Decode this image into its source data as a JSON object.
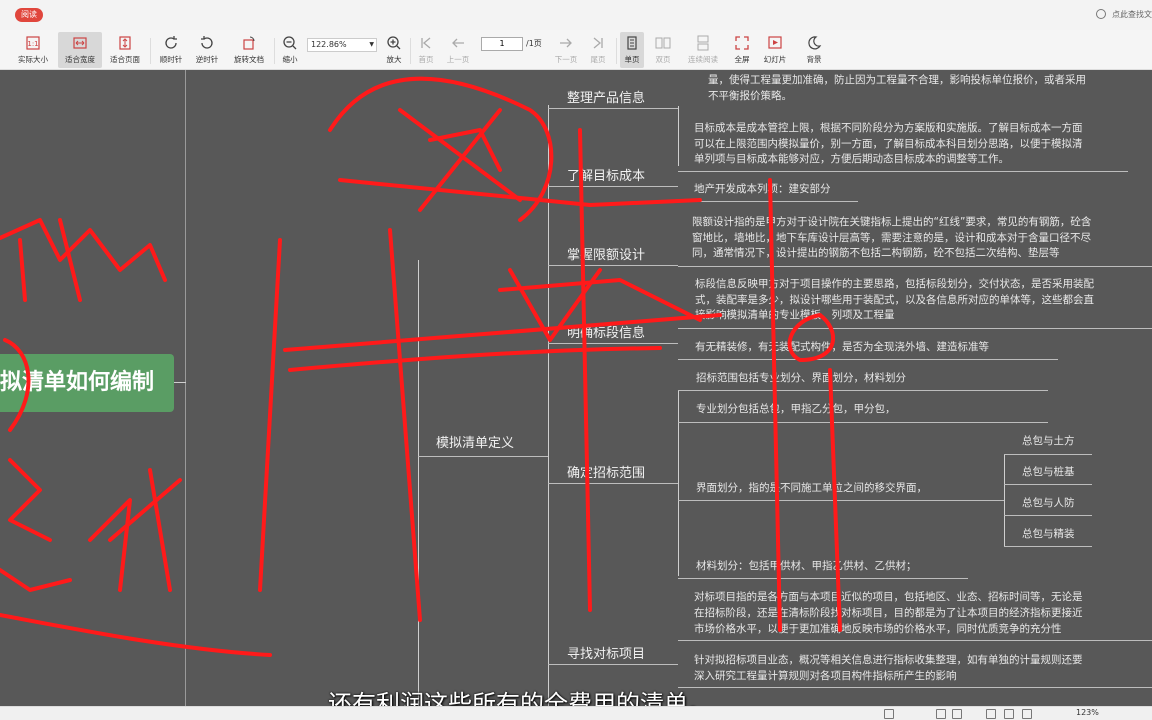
{
  "topbar": {
    "mode_badge": "阅读",
    "search_placeholder": "点此查找文"
  },
  "toolbar": {
    "actual_size": "实际大小",
    "fit_width": "适合宽度",
    "fit_page": "适合页面",
    "rotate_cw": "顺时针",
    "rotate_ccw": "逆时针",
    "rotate_doc": "旋转文档",
    "zoom_out": "缩小",
    "zoom_value": "122.86%",
    "zoom_in": "放大",
    "first_page": "首页",
    "prev_page": "上一页",
    "page_current": "1",
    "page_total": "/1页",
    "next_page": "下一页",
    "last_page": "尾页",
    "single_page": "单页",
    "double_page": "双页",
    "continuous": "连续阅读",
    "fullscreen": "全屏",
    "slideshow": "幻灯片",
    "background": "背景"
  },
  "mindmap": {
    "root": "拟清单如何编制",
    "branch": "模拟清单定义",
    "nodes": [
      "整理产品信息",
      "了解目标成本",
      "掌握限额设计",
      "明确标段信息",
      "确定招标范围",
      "寻找对标项目"
    ],
    "leaves": {
      "product_info": [
        "量，使得工程量更加准确，防止因为工程量不合理，影响投标单位报价，或者采用",
        "不平衡报价策略。"
      ],
      "target_cost": [
        "目标成本是成本管控上限，根据不同阶段分为方案版和实施版。了解目标成本一方面",
        "可以在上限范围内模拟量价，别一方面，了解目标成本科目划分思路，以便于模拟清",
        "单列项与目标成本能够对应，方便后期动态目标成本的调整等工作。"
      ],
      "cost_items": "地产开发成本列项：建安部分",
      "limit_design": [
        "限额设计指的是甲方对于设计院在关键指标上提出的“红线”要求，常见的有钢筋，砼含",
        "窗地比，墙地比，地下车库设计层高等，需要注意的是，设计和成本对于含量口径不尽",
        "同，通常情况下，设计提出的钢筋不包括二构钢筋，砼不包括二次结构、垫层等"
      ],
      "section_info": [
        "标段信息反映甲方对于项目操作的主要思路，包括标段划分，交付状态，是否采用装配",
        "式，装配率是多少，拟设计哪些用于装配式，以及各信息所对应的单体等，这些都会直",
        "接影响模拟清单的专业模板、列项及工程量"
      ],
      "decoration": "有无精装修，有无装配式构件，是否为全现浇外墙、建造标准等",
      "scope_intro": "招标范围包括专业划分、界面划分，材料划分",
      "scope_pro": "专业划分包括总包，甲指乙分包，甲分包，",
      "scope_interface": "界面划分，指的是不同施工单位之间的移交界面，",
      "scope_interface_items": [
        "总包与土方",
        "总包与桩基",
        "总包与人防",
        "总包与精装"
      ],
      "scope_material": "材料划分：包括甲供材、甲指乙供材、乙供材；",
      "benchmark_1": [
        "对标项目指的是各方面与本项目近似的项目，包括地区、业态、招标时间等，无论是",
        "在招标阶段，还是在清标阶段找对标项目，目的都是为了让本项目的经济指标更接近",
        "市场价格水平，以便于更加准确地反映市场的价格水平，同时优质竞争的充分性"
      ],
      "benchmark_2": [
        "针对拟招标项目业态，概况等相关信息进行指标收集整理，如有单独的计量规则还要",
        "深入研究工程量计算规则对各项目构件指标所产生的影响"
      ]
    }
  },
  "subtitle": "还有利润这些所有的全费用的清单。",
  "statusbar": {
    "zoom": "123%"
  },
  "colors": {
    "canvas": "#585858",
    "root_node": "#5a9d64",
    "ink": "#ff1a1a",
    "badge": "#e0463c"
  }
}
